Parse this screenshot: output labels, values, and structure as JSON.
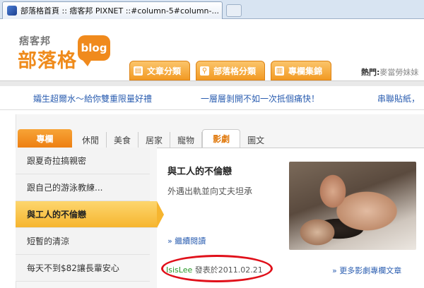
{
  "browser": {
    "tab_title": "部落格首頁 :: 痞客邦 PIXNET ::#column-5#column-..."
  },
  "logo": {
    "subtitle": "痞客邦",
    "title": "部落格",
    "badge": "blog",
    "color": "#ef8b1c"
  },
  "topnav": {
    "items": [
      {
        "label": "文章分類"
      },
      {
        "label": "部落格分類"
      },
      {
        "label": "專欄集錦"
      }
    ],
    "hot_label": "熱門:",
    "hot_value": "麥當勞妹妹"
  },
  "promo": {
    "links": [
      "孀生超爾水～給你雙重限量好禮",
      "一層層剝開不如一次抵個痛快！",
      "串聯貼紙，"
    ]
  },
  "categories": {
    "items": [
      "專欄",
      "休閒",
      "美食",
      "居家",
      "寵物",
      "影劇",
      "圖文"
    ],
    "active": "影劇"
  },
  "sidebar": {
    "items": [
      "跟夏奇拉搞親密",
      "跟自己的游泳教練...",
      "與工人的不倫戀",
      "短暫的清涼",
      "每天不到$82讓長輩安心"
    ],
    "selected_index": 2
  },
  "article": {
    "title": "與工人的不倫戀",
    "description": "外遇出軌並向丈夫坦承",
    "read_more": "» 繼續閱讀",
    "author": "IsisLee",
    "published_text": "發表於2011.02.21",
    "more_link": "» 更多影劇專欄文章"
  },
  "colors": {
    "accent": "#f29a23",
    "link": "#2a5db0",
    "highlight_oval": "#e0101a"
  }
}
